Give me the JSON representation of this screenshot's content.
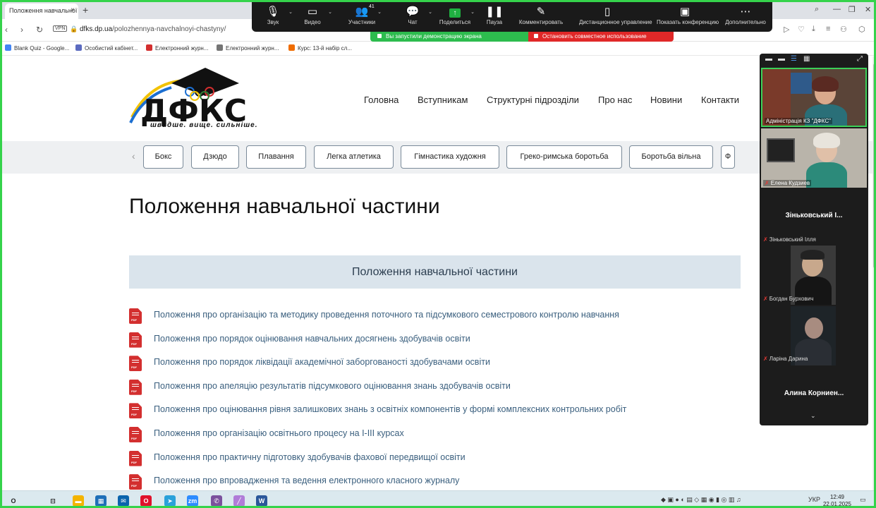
{
  "browser": {
    "tab_title": "Положення навчальної ·",
    "tab_close": "×",
    "new_tab": "+",
    "vpn": "VPN",
    "url_domain": "dfks.dp.ua",
    "url_path": "/polozhennya-navchalnoyi-chastyny/",
    "bookmarks": [
      {
        "label": "Blank Quiz - Google...",
        "color": "#4285f4"
      },
      {
        "label": "Особистий кабінет...",
        "color": "#5c6bc0"
      },
      {
        "label": "Електронний журн...",
        "color": "#d32f2f"
      },
      {
        "label": "Електронний журн...",
        "color": "#757575"
      },
      {
        "label": "Курс: 13-й набір сл...",
        "color": "#ef6c00"
      }
    ]
  },
  "zoom": {
    "participants_count": "41",
    "toolbar": [
      {
        "label": "Звук",
        "icon": "mic-icon",
        "glyph": "🎙"
      },
      {
        "label": "Видео",
        "icon": "camera-icon",
        "glyph": "▭"
      },
      {
        "label": "Участники",
        "icon": "participants-icon",
        "glyph": "👥"
      },
      {
        "label": "Чат",
        "icon": "chat-icon",
        "glyph": "💬"
      },
      {
        "label": "Поделиться",
        "icon": "share-icon",
        "glyph": "↑"
      },
      {
        "label": "Пауза",
        "icon": "pause-icon",
        "glyph": "❚❚"
      },
      {
        "label": "Комментировать",
        "icon": "annotate-icon",
        "glyph": "✎"
      },
      {
        "label": "Дистанционное управление",
        "icon": "remote-control-icon",
        "glyph": "▯"
      },
      {
        "label": "Показать конференцию",
        "icon": "show-meeting-icon",
        "glyph": "▣"
      },
      {
        "label": "Дополнительно",
        "icon": "more-icon",
        "glyph": "⋯"
      }
    ],
    "sharing_notice": "Вы запустили демонстрацию экрана",
    "stop_sharing": "Остановить совместное использование",
    "participants": {
      "admin": "Адміністрація КЗ \"ДФКС\"",
      "elena": "Елена Кудзиев",
      "zinkovsky_tile": "Зіньковський І...",
      "zinkovsky_name": "Зіньковський Ілля",
      "bohdan": "Богдан Бурхович",
      "daryna": "Ларіна Дарина",
      "alina_tile": "Алина Корниен..."
    }
  },
  "site": {
    "logo_text": "ДФКС",
    "logo_slogan": "швидше. вище. сильніше.",
    "nav": [
      "Головна",
      "Вступникам",
      "Структурні підрозділи",
      "Про нас",
      "Новини",
      "Контакти"
    ],
    "categories": [
      "Бокс",
      "Дзюдо",
      "Плавання",
      "Легка атлетика",
      "Гімнастика художня",
      "Греко-римська боротьба",
      "Боротьба вільна",
      "Ф"
    ],
    "page_title": "Положення навчальної частини",
    "section_title": "Положення навчальної частини",
    "pdf_label": "PDF",
    "documents": [
      "Положення про організацію та методику проведення поточного та підсумкового семестрового контролю навчання",
      "Положення про порядок оцінювання навчальних досягнень здобувачів освіти",
      "Положення про порядок ліквідації академічної заборгованості здобувачами освіти",
      "Положення про апеляцію результатів підсумкового оцінювання знань здобувачів освіти",
      "Положення про оцінювання рівня залишкових знань з освітніх компонентів у формі комплексних контрольних робіт",
      "Положення про організацію освітнього процесу на I-III курсах",
      "Положення про практичну підготовку здобувачів фахової передвищої освіти",
      "Положення про впровадження та ведення електронного класного журналу"
    ]
  },
  "taskbar": {
    "language": "УКР",
    "time": "12:49",
    "date": "22.01.2025",
    "apps": [
      {
        "icon": "search-icon",
        "glyph": "O",
        "color": "#dbe9ef",
        "fg": "#222"
      },
      {
        "icon": "task-view-icon",
        "glyph": "⊟",
        "color": "#dbe9ef",
        "fg": "#222"
      },
      {
        "icon": "file-explorer-icon",
        "glyph": "▬",
        "color": "#f4b400",
        "fg": "#fff"
      },
      {
        "icon": "calculator-icon",
        "glyph": "▦",
        "color": "#1e6fb8",
        "fg": "#fff"
      },
      {
        "icon": "mail-icon",
        "glyph": "✉",
        "color": "#0a64ad",
        "fg": "#fff"
      },
      {
        "icon": "opera-icon",
        "glyph": "O",
        "color": "#e0112b",
        "fg": "#fff"
      },
      {
        "icon": "telegram-icon",
        "glyph": "➤",
        "color": "#2aa1da",
        "fg": "#fff"
      },
      {
        "icon": "zoom-icon",
        "glyph": "zm",
        "color": "#2d8cff",
        "fg": "#fff"
      },
      {
        "icon": "viber-icon",
        "glyph": "✆",
        "color": "#7b519d",
        "fg": "#fff"
      },
      {
        "icon": "pen-icon",
        "glyph": "╱",
        "color": "#b07cd8",
        "fg": "#fff"
      },
      {
        "icon": "word-icon",
        "glyph": "W",
        "color": "#2b579a",
        "fg": "#fff"
      }
    ]
  }
}
